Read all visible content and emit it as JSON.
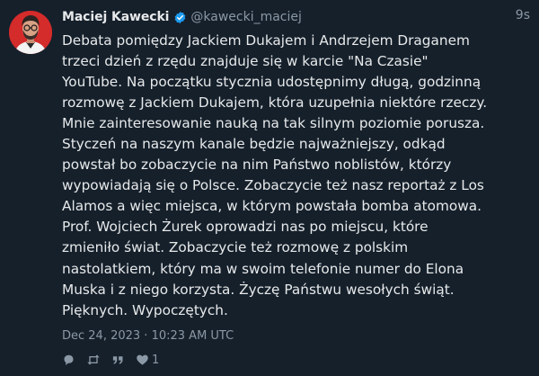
{
  "author": {
    "display_name": "Maciej Kawecki",
    "handle": "@kawecki_maciej",
    "verified": true,
    "avatar_icon": "avatar-photo"
  },
  "tweet": {
    "relative_time": "9s",
    "text": "Debata pomiędzy Jackiem Dukajem i Andrzejem Draganem\ntrzeci dzień z rzędu znajduje się w karcie \"Na Czasie\"\nYouTube. Na początku stycznia udostępnimy długą, godzinną\nrozmowę z Jackiem Dukajem, która uzupełnia niektóre rzeczy.\nMnie zainteresowanie nauką na tak silnym poziomie porusza.\nStyczeń na naszym kanale będzie najważniejszy, odkąd\npowstał bo zobaczycie na nim Państwo noblistów, którzy\nwypowiadają się o Polsce. Zobaczycie też nasz reportaż z Los\nAlamos a więc miejsca, w którym powstała bomba atomowa.\nProf. Wojciech Żurek oprowadzi nas po miejscu, które\nzmieniło świat. Zobaczycie też rozmowę z polskim\nnastolatkiem, który ma w swoim telefonie numer do Elona\nMuska i z niego korzysta. Życzę Państwu wesołych świąt.\nPięknych. Wypoczętych.",
    "timestamp": "Dec 24, 2023 · 10:23 AM UTC"
  },
  "actions": {
    "reply_icon": "reply-icon",
    "retweet_icon": "retweet-icon",
    "quote_icon": "quote-icon",
    "like_icon": "heart-icon",
    "like_count": "1"
  },
  "colors": {
    "background": "#15202b",
    "text": "#e7e9ea",
    "muted": "#8b98a5",
    "verified": "#1d9bf0",
    "avatar_bg": "#d42b2b"
  }
}
